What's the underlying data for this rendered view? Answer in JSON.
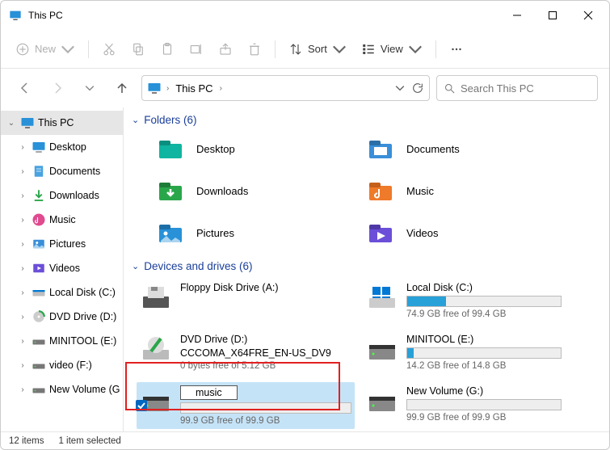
{
  "window": {
    "title": "This PC"
  },
  "toolbar": {
    "new": "New",
    "sort": "Sort",
    "view": "View"
  },
  "breadcrumb": {
    "root": "This PC"
  },
  "search": {
    "placeholder": "Search This PC"
  },
  "sidebar": {
    "root": "This PC",
    "items": [
      {
        "label": "Desktop"
      },
      {
        "label": "Documents"
      },
      {
        "label": "Downloads"
      },
      {
        "label": "Music"
      },
      {
        "label": "Pictures"
      },
      {
        "label": "Videos"
      },
      {
        "label": "Local Disk (C:)"
      },
      {
        "label": "DVD Drive (D:)"
      },
      {
        "label": "MINITOOL (E:)"
      },
      {
        "label": "video (F:)"
      },
      {
        "label": "New Volume (G"
      }
    ]
  },
  "groups": {
    "folders": {
      "header": "Folders (6)",
      "items": [
        {
          "label": "Desktop"
        },
        {
          "label": "Documents"
        },
        {
          "label": "Downloads"
        },
        {
          "label": "Music"
        },
        {
          "label": "Pictures"
        },
        {
          "label": "Videos"
        }
      ]
    },
    "drives": {
      "header": "Devices and drives (6)",
      "items": [
        {
          "name": "Floppy Disk Drive (A:)",
          "free": "",
          "pct": null
        },
        {
          "name": "Local Disk (C:)",
          "free": "74.9 GB free of 99.4 GB",
          "pct": 25
        },
        {
          "name": "DVD Drive (D:)",
          "sub": "CCCOMA_X64FRE_EN-US_DV9",
          "free": "0 bytes free of 5.12 GB",
          "pct": null
        },
        {
          "name": "MINITOOL (E:)",
          "free": "14.2 GB free of 14.8 GB",
          "pct": 4
        },
        {
          "name_editing": "music",
          "free": "99.9 GB free of 99.9 GB",
          "pct": 0
        },
        {
          "name": "New Volume (G:)",
          "free": "99.9 GB free of 99.9 GB",
          "pct": 0
        }
      ]
    }
  },
  "status": {
    "count": "12 items",
    "selected": "1 item selected"
  }
}
